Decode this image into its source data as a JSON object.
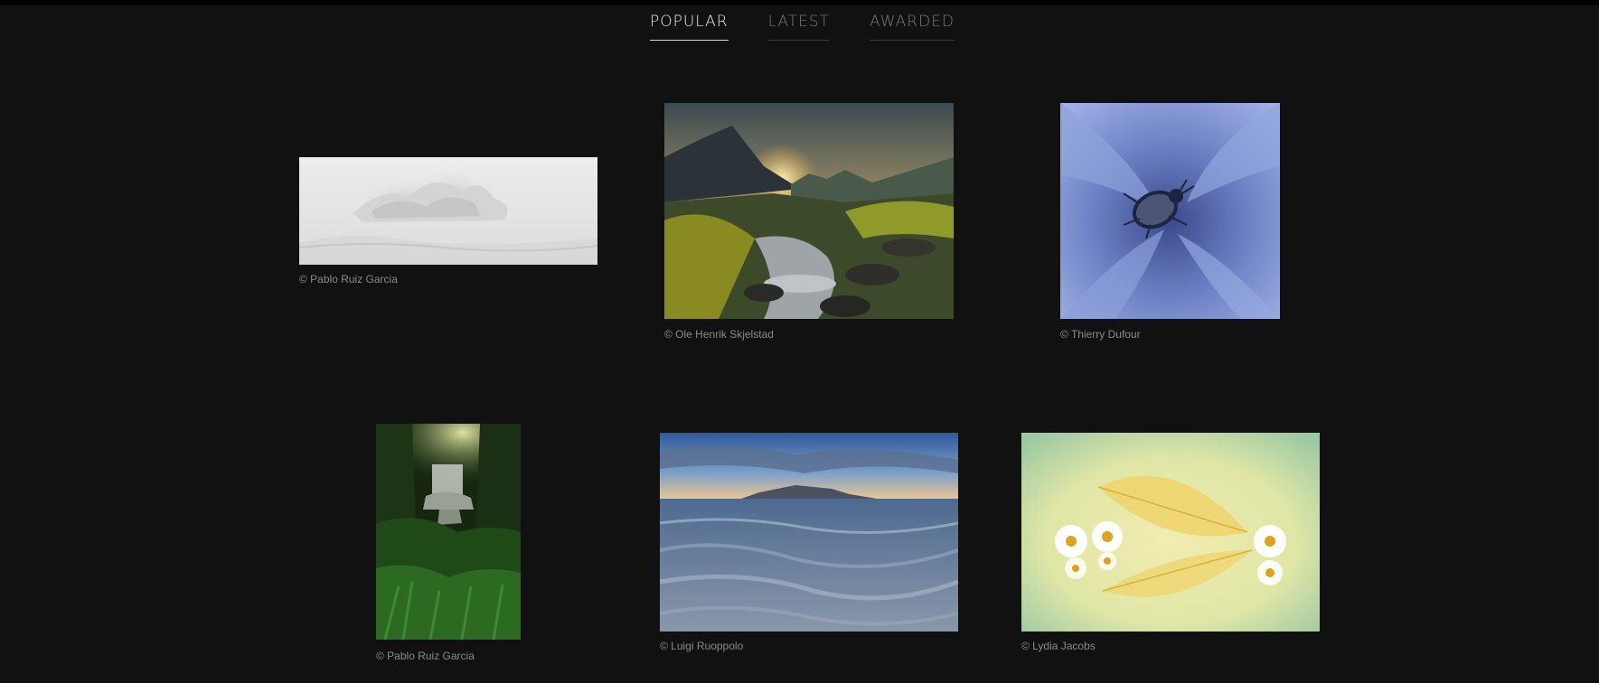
{
  "nav": {
    "tabs": [
      {
        "label": "POPULAR",
        "active": true
      },
      {
        "label": "LATEST",
        "active": false
      },
      {
        "label": "AWARDED",
        "active": false
      }
    ]
  },
  "gallery": {
    "photos": [
      {
        "credit": "© Pablo Ruiz Garcia",
        "subject": "black and white crashing wave"
      },
      {
        "credit": "© Ole Henrik Skjelstad",
        "subject": "mountain stream at sunrise"
      },
      {
        "credit": "© Thierry Dufour",
        "subject": "beetle on blue flower petal"
      },
      {
        "credit": "© Pablo Ruiz Garcia",
        "subject": "forest waterfall"
      },
      {
        "credit": "© Luigi Ruoppolo",
        "subject": "beach at dusk with island"
      },
      {
        "credit": "© Lydia Jacobs",
        "subject": "daisies and golden leaf"
      }
    ]
  },
  "colors": {
    "background": "#111111",
    "tab_active": "#e9e9e9",
    "tab_inactive": "#7a7a7a",
    "caption": "#8a8a8a"
  }
}
